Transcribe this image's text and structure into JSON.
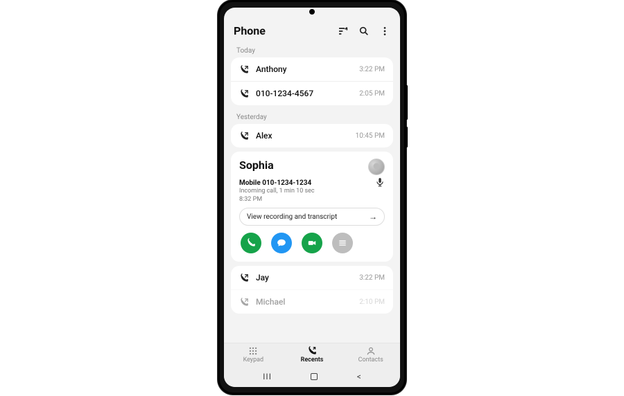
{
  "header": {
    "title": "Phone"
  },
  "sections": [
    {
      "label": "Today",
      "rows": [
        {
          "dir": "out",
          "name": "Anthony",
          "time": "3:22 PM"
        },
        {
          "dir": "out",
          "name": "010-1234-4567",
          "time": "2:05 PM"
        }
      ]
    },
    {
      "label": "Yesterday",
      "rows": [
        {
          "dir": "out",
          "name": "Alex",
          "time": "10:45 PM"
        }
      ]
    }
  ],
  "detail": {
    "name": "Sophia",
    "number_label": "Mobile 010-1234-1234",
    "meta": "Incoming call, 1 min 10 sec",
    "when": "8:32 PM",
    "pill_label": "View recording and transcript"
  },
  "after_rows": [
    {
      "dir": "out",
      "name": "Jay",
      "time": "3:22 PM"
    },
    {
      "dir": "out",
      "name": "Michael",
      "time": "2:10 PM"
    }
  ],
  "nav": {
    "keypad": "Keypad",
    "recents": "Recents",
    "contacts": "Contacts"
  }
}
